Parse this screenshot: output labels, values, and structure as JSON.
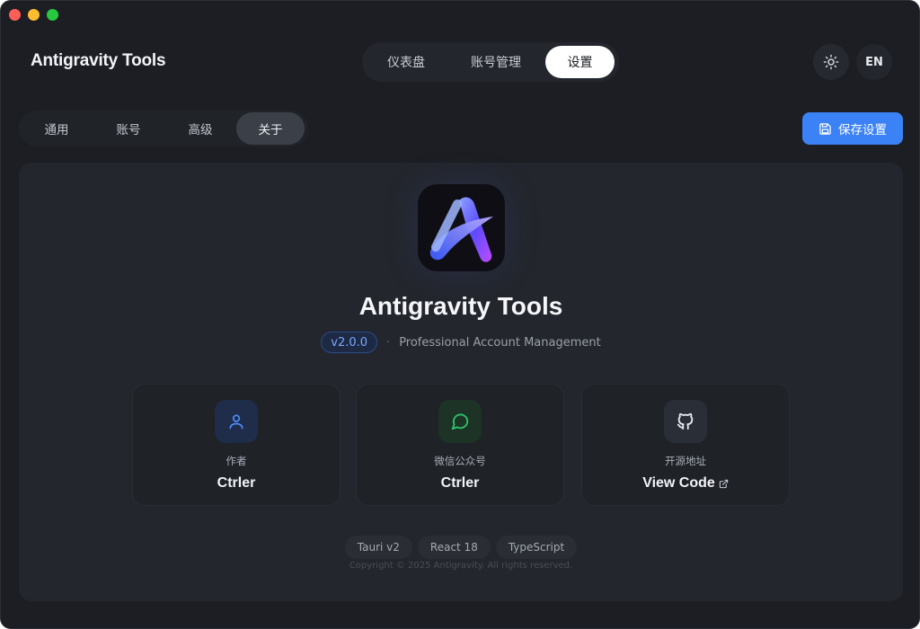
{
  "app": {
    "title": "Antigravity Tools"
  },
  "main_nav": {
    "tabs": [
      {
        "label": "仪表盘"
      },
      {
        "label": "账号管理"
      },
      {
        "label": "设置"
      }
    ],
    "active": "设置"
  },
  "header": {
    "theme_icon": "sun-icon",
    "lang_label": "EN"
  },
  "settings_nav": {
    "tabs": [
      {
        "label": "通用"
      },
      {
        "label": "账号"
      },
      {
        "label": "高级"
      },
      {
        "label": "关于"
      }
    ],
    "active": "关于"
  },
  "save_button": {
    "label": "保存设置",
    "icon": "save-icon"
  },
  "about": {
    "name": "Antigravity Tools",
    "version": "v2.0.0",
    "separator": "·",
    "tagline": "Professional Account Management",
    "cards": [
      {
        "icon": "user-icon",
        "label": "作者",
        "value": "Ctrler",
        "accent": "#3b82f6"
      },
      {
        "icon": "message-circle-icon",
        "label": "微信公众号",
        "value": "Ctrler",
        "accent": "#22c55e"
      },
      {
        "icon": "github-icon",
        "label": "开源地址",
        "value": "View Code",
        "link_icon": "external-link-icon",
        "accent": "#e5e7eb"
      }
    ],
    "tech_stack": [
      "Tauri v2",
      "React 18",
      "TypeScript"
    ],
    "copyright": "Copyright © 2025 Antigravity. All rights reserved."
  },
  "colors": {
    "background": "#1c1e23",
    "panel": "#23262c",
    "accent": "#3b82f6",
    "version_text": "#7aa7ff"
  }
}
